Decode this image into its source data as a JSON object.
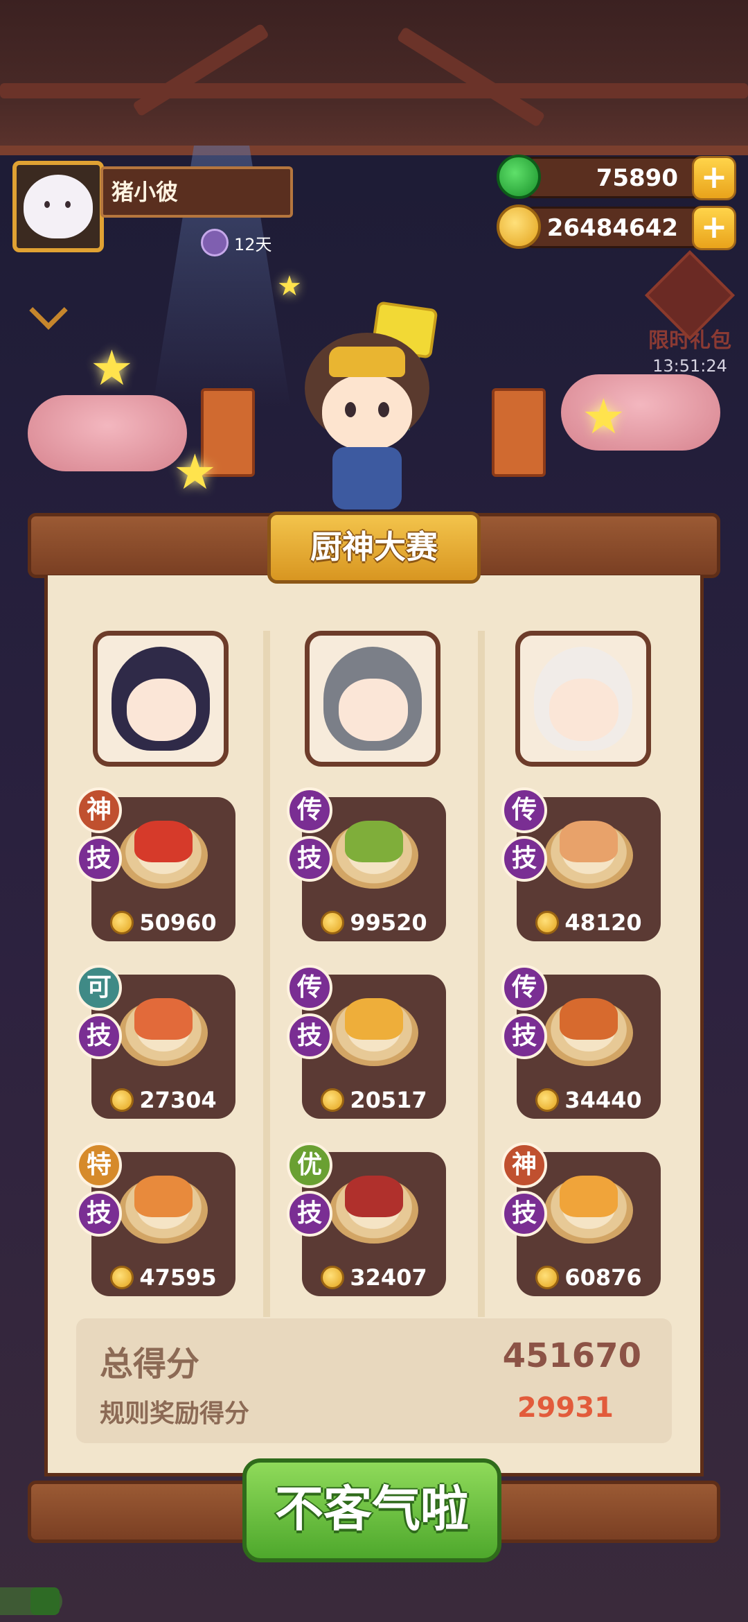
{
  "player": {
    "name": "猪小彼",
    "days": "12天",
    "avatar_icon": "cat-avatar-icon"
  },
  "currency": {
    "jade": "75890",
    "gold": "26484642",
    "plus_label": "+"
  },
  "gift": {
    "label": "限时礼包",
    "timer": "13:51:24"
  },
  "contest": {
    "title": "厨神大赛"
  },
  "chefs": [
    {
      "portrait": "chef-portrait-girl-crown",
      "dishes": [
        {
          "rank": "神",
          "rank_color": "#c0502f",
          "skill": "技",
          "score": "50960",
          "food_color": "#d63a2a"
        },
        {
          "rank": "可",
          "rank_color": "#3f8a86",
          "skill": "技",
          "score": "27304",
          "food_color": "#e26a3a"
        },
        {
          "rank": "特",
          "rank_color": "#d68a2a",
          "skill": "技",
          "score": "47595",
          "food_color": "#e88a3c"
        }
      ]
    },
    {
      "portrait": "chef-portrait-grey-hair",
      "dishes": [
        {
          "rank": "传",
          "rank_color": "#7a2e93",
          "skill": "技",
          "score": "99520",
          "food_color": "#7fae3a"
        },
        {
          "rank": "传",
          "rank_color": "#7a2e93",
          "skill": "技",
          "score": "20517",
          "food_color": "#eeae3a"
        },
        {
          "rank": "优",
          "rank_color": "#6aa032",
          "skill": "技",
          "score": "32407",
          "food_color": "#b0302c"
        }
      ]
    },
    {
      "portrait": "chef-portrait-white-hood",
      "dishes": [
        {
          "rank": "传",
          "rank_color": "#7a2e93",
          "skill": "技",
          "score": "48120",
          "food_color": "#e8a26a"
        },
        {
          "rank": "传",
          "rank_color": "#7a2e93",
          "skill": "技",
          "score": "34440",
          "food_color": "#d76a2e"
        },
        {
          "rank": "神",
          "rank_color": "#c0502f",
          "skill": "技",
          "score": "60876",
          "food_color": "#f0a43a"
        }
      ]
    }
  ],
  "summary": {
    "total_label": "总得分",
    "total_value": "451670",
    "bonus_label": "规则奖励得分",
    "bonus_value": "29931"
  },
  "action": {
    "confirm_label": "不客气啦"
  }
}
